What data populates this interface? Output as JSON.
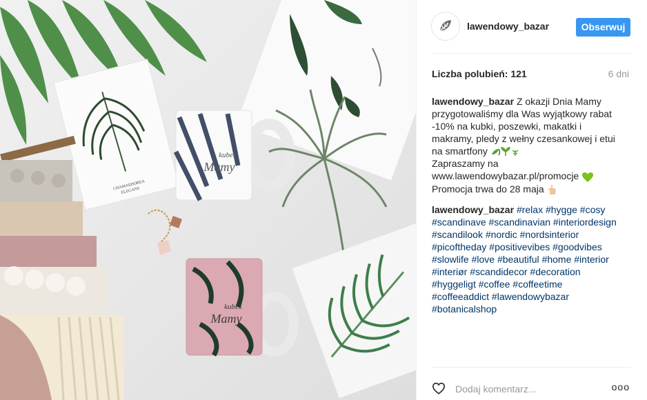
{
  "post": {
    "username": "lawendowy_bazar",
    "follow_label": "Obserwuj",
    "likes_text": "Liczba polubień: 121",
    "age_text": "6 dni"
  },
  "caption": {
    "author": "lawendowy_bazar",
    "lines": [
      "Z okazji Dnia Mamy",
      "przygotowaliśmy dla Was wyjątkowy rabat",
      "-10% na kubki, poszewki, makatki i",
      "makramy, pledy z wełny czesankowej i etui",
      "na smartfony",
      "Zapraszamy na",
      "www.lawendowybazar.pl/promocje",
      "Promocja trwa do 28 maja"
    ]
  },
  "hashtags_comment": {
    "author": "lawendowy_bazar",
    "tags": [
      "#relax",
      "#hygge",
      "#cosy",
      "#scandinave",
      "#scandinavian",
      "#interiordesign",
      "#scandilook",
      "#nordic",
      "#nordsinterior",
      "#picoftheday",
      "#positivevibes",
      "#goodvibes",
      "#slowlife",
      "#love",
      "#beautiful",
      "#home",
      "#interior",
      "#interiør",
      "#scandidecor",
      "#decoration",
      "#hyggeligt",
      "#coffee",
      "#coffeetime",
      "#coffeeaddict",
      "#lawendowybazar",
      "#botanicalshop"
    ]
  },
  "comment_box": {
    "placeholder": "Dodaj komentarz...",
    "more_label": "ooo"
  },
  "photo": {
    "mug_top_text": [
      "kubek",
      "Mamy"
    ],
    "mug_bottom_text": [
      "kubek",
      "Mamy"
    ],
    "card_text": [
      "CHAMAEDOREA",
      "ELEGANS"
    ]
  },
  "icons": {
    "avatar": "leaf-logo-icon",
    "heart": "heart-icon",
    "caption_emoji": "seedling-emoji",
    "heart_emoji": "green-heart-emoji",
    "hand_emoji": "pointing-hand-emoji"
  },
  "colors": {
    "follow_button": "#3897f0",
    "hashtag": "#003569",
    "meta_grey": "#999999"
  }
}
